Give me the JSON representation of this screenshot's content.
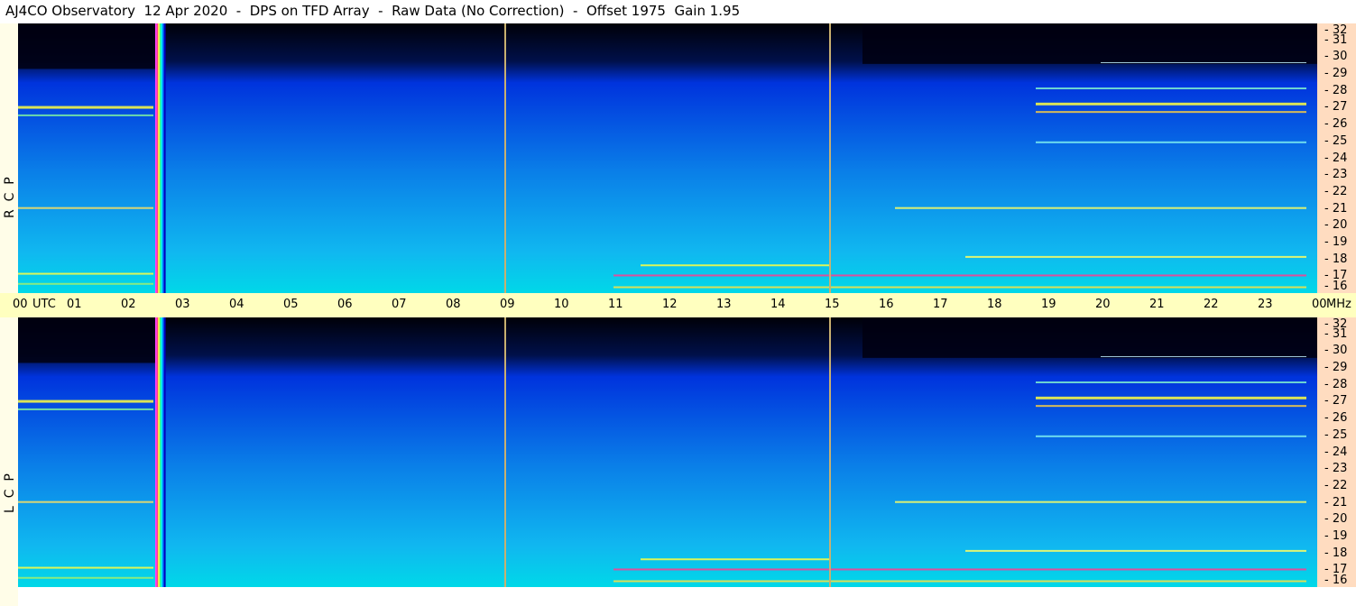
{
  "title": "AJ4CO Observatory  12 Apr 2020  -  DPS on TFD Array  -  Raw Data (No Correction)  -  Offset 1975  Gain 1.95",
  "panels": [
    {
      "id": "rcp",
      "label": "R  C  P"
    },
    {
      "id": "lcp",
      "label": "L  C  P"
    }
  ],
  "time_axis": {
    "ticks": [
      "00",
      "01",
      "02",
      "03",
      "04",
      "05",
      "06",
      "07",
      "08",
      "09",
      "10",
      "11",
      "12",
      "13",
      "14",
      "15",
      "16",
      "17",
      "18",
      "19",
      "20",
      "21",
      "22",
      "23",
      "00"
    ],
    "utc_label": "UTC",
    "mhz_label": "MHz"
  },
  "chart_data": {
    "type": "heatmap",
    "title": "AJ4CO Observatory  12 Apr 2020  -  DPS on TFD Array  -  Raw Data (No Correction)  -  Offset 1975  Gain 1.95",
    "x_range_utc_hours": [
      0,
      24
    ],
    "y_range_mhz": [
      16,
      32
    ],
    "y_ticks_mhz": [
      32,
      31,
      30,
      29,
      28,
      27,
      26,
      25,
      24,
      23,
      22,
      21,
      20,
      19,
      18,
      17,
      16
    ],
    "x_ticks_utc": [
      "00",
      "01",
      "02",
      "03",
      "04",
      "05",
      "06",
      "07",
      "08",
      "09",
      "10",
      "11",
      "12",
      "13",
      "14",
      "15",
      "16",
      "17",
      "18",
      "19",
      "20",
      "21",
      "22",
      "23",
      "00"
    ],
    "vertical_markers_utc": [
      9,
      15
    ],
    "broadband_burst_utc": 2.6,
    "series": [
      {
        "name": "RCP"
      },
      {
        "name": "LCP"
      }
    ],
    "colors": {
      "background_low": "#000010",
      "mid": "#0033dd",
      "high": "#00d8e8",
      "hot": "#ffff40",
      "marker": "#c8b070"
    }
  }
}
